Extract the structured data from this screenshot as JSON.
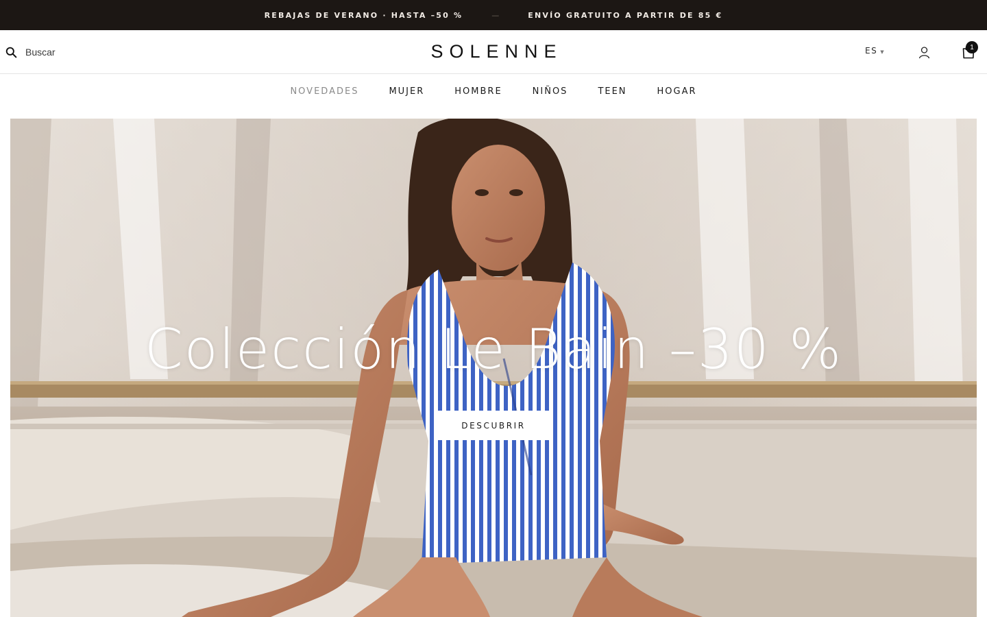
{
  "announcement": {
    "left": "REBAJAS DE VERANO · HASTA –50 %",
    "separator": "—",
    "right": "ENVÍO GRATUITO A PARTIR DE 85 €"
  },
  "header": {
    "search_placeholder": "Buscar",
    "logo": "SOLENNE",
    "language": "ES",
    "cart_count": "1",
    "icons": [
      "search-icon",
      "user-icon",
      "shopping-bag-icon",
      "chevron-down-icon"
    ]
  },
  "nav": {
    "items": [
      {
        "label": "NOVEDADES",
        "active": true
      },
      {
        "label": "MUJER",
        "active": false
      },
      {
        "label": "HOMBRE",
        "active": false
      },
      {
        "label": "NIÑOS",
        "active": false
      },
      {
        "label": "TEEN",
        "active": false
      },
      {
        "label": "HOGAR",
        "active": false
      }
    ]
  },
  "hero": {
    "title": "Colección Le Bain –30 %",
    "cta": "DESCUBRIR"
  },
  "colors": {
    "announcement_bg": "#1c1714",
    "nav_active": "#8a8a8a",
    "swimsuit_blue": "#3e63c4"
  }
}
